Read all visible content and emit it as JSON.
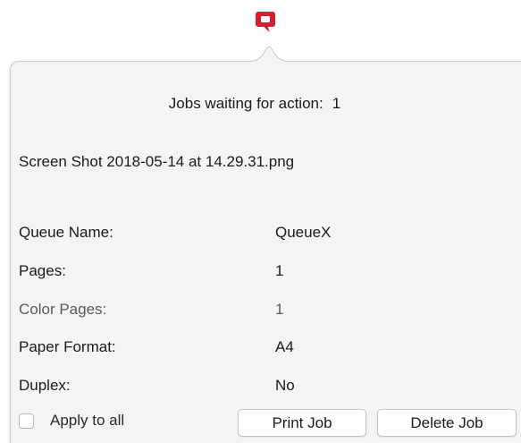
{
  "app": {
    "icon": "quota-print-icon",
    "accent_color": "#d1202f"
  },
  "summary": {
    "label": "Jobs waiting for action:",
    "count": "1"
  },
  "job": {
    "filename": "Screen Shot 2018-05-14 at 14.29.31.png",
    "details": [
      {
        "label": "Queue Name:",
        "value": "QueueX"
      },
      {
        "label": "Pages:",
        "value": "1"
      },
      {
        "label": "Color Pages:",
        "value": "1"
      },
      {
        "label": "Paper Format:",
        "value": "A4"
      },
      {
        "label": "Duplex:",
        "value": "No"
      }
    ]
  },
  "footer": {
    "apply_all_label": "Apply to all",
    "apply_all_checked": false,
    "print_label": "Print Job",
    "delete_label": "Delete Job"
  }
}
